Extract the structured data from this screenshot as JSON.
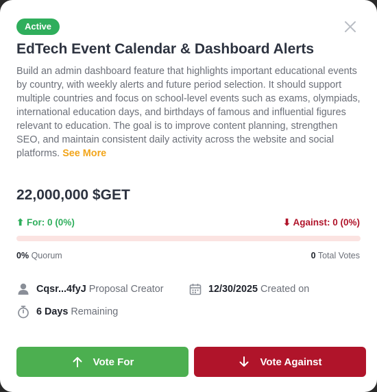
{
  "status": {
    "label": "Active",
    "color": "#2fae5c"
  },
  "proposal": {
    "title": "EdTech Event Calendar & Dashboard Alerts",
    "description": "Build an admin dashboard feature that highlights important educational events by country, with weekly alerts and future period selection. It should support multiple countries and focus on school-level events such as exams, olympiads, international education days, and birthdays of famous and influential figures relevant to education. The goal is to improve content planning, strengthen SEO, and maintain consistent daily activity across the website and social platforms.",
    "see_more_label": "See More",
    "amount": "22,000,000 $GET"
  },
  "votes": {
    "for_label": "⬆ For: 0 (0%)",
    "against_label": "⬇ Against: 0 (0%)",
    "for_fraction": 0,
    "quorum_value": "0%",
    "quorum_label": "Quorum",
    "total_value": "0",
    "total_label": "Total Votes"
  },
  "meta": {
    "creator_value": "Cqsr...4fyJ",
    "creator_label": "Proposal Creator",
    "created_value": "12/30/2025",
    "created_label": "Created on",
    "remaining_value": "6 Days",
    "remaining_label": "Remaining"
  },
  "buttons": {
    "vote_for": "Vote For",
    "vote_against": "Vote Against"
  },
  "icons": {
    "close": "close-icon",
    "creator": "user-icon",
    "created": "calendar-icon",
    "remaining": "stopwatch-icon",
    "vote_for": "arrow-up-icon",
    "vote_against": "arrow-down-icon"
  },
  "colors": {
    "for": "#2fae5c",
    "against": "#b0142a",
    "accent": "#f2a51a"
  }
}
